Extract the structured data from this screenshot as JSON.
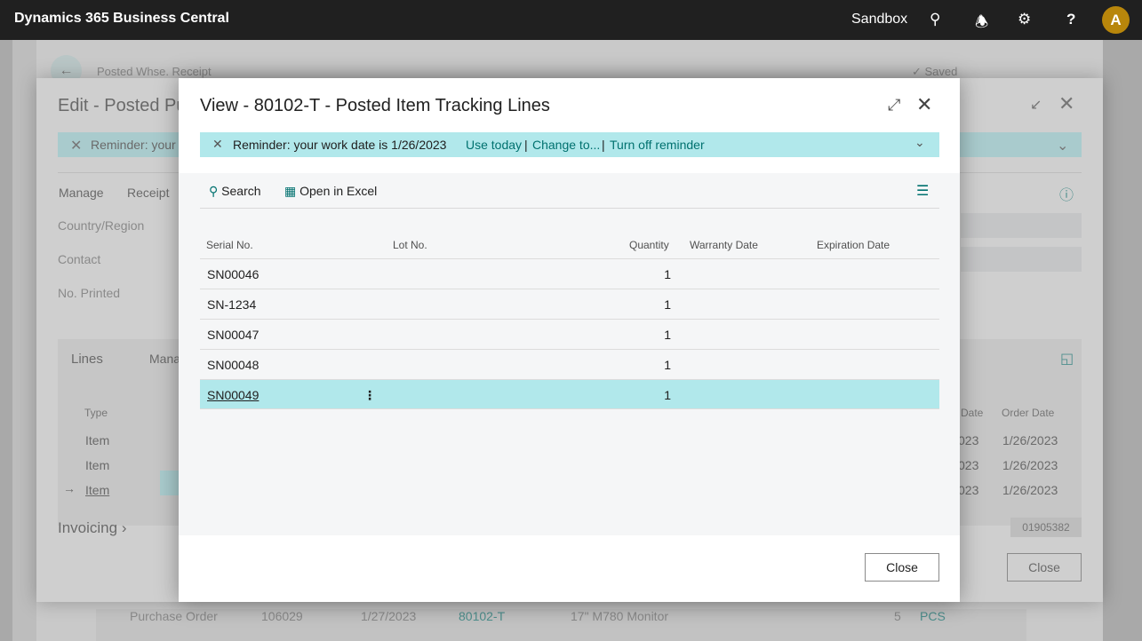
{
  "app": {
    "title": "Dynamics 365 Business Central",
    "environment": "Sandbox",
    "avatar_initial": "A"
  },
  "background_page": {
    "breadcrumb": "Posted Whse. Receipt",
    "saved_label": "Saved",
    "title": "Edit - Posted Pu",
    "reminder": "Reminder: your w",
    "actions": [
      "Manage",
      "Receipt"
    ],
    "fields": [
      "Country/Region",
      "Contact",
      "No. Printed"
    ],
    "lines_tab": "Lines",
    "lines_manage": "Mana",
    "type_header": "Type",
    "date_header_partial": "Date",
    "order_date_header": "Order Date",
    "lines": [
      {
        "type": "Item",
        "date": "023",
        "order_date": "1/26/2023"
      },
      {
        "type": "Item",
        "date": "023",
        "order_date": "1/26/2023"
      },
      {
        "type": "Item",
        "date": "023",
        "order_date": "1/26/2023"
      }
    ],
    "invoicing": "Invoicing",
    "code_box": "01905382",
    "close_label": "Close",
    "bottom_row": {
      "doc_type": "Purchase Order",
      "no": "106029",
      "date": "1/27/2023",
      "item": "80102-T",
      "description": "17\" M780 Monitor",
      "qty": "5",
      "uom": "PCS"
    }
  },
  "dialog": {
    "title": "View - 80102-T - Posted Item Tracking Lines",
    "reminder": {
      "text": "Reminder: your work date is 1/26/2023",
      "use_today": "Use today",
      "change_to": "Change to...",
      "turn_off": "Turn off reminder"
    },
    "toolbar": {
      "search": "Search",
      "open_excel": "Open in Excel"
    },
    "columns": [
      "Serial No.",
      "Lot No.",
      "Quantity",
      "Warranty Date",
      "Expiration Date"
    ],
    "rows": [
      {
        "serial": "SN00046",
        "lot": "",
        "qty": "1",
        "warranty": "",
        "expiration": ""
      },
      {
        "serial": "SN-1234",
        "lot": "",
        "qty": "1",
        "warranty": "",
        "expiration": ""
      },
      {
        "serial": "SN00047",
        "lot": "",
        "qty": "1",
        "warranty": "",
        "expiration": ""
      },
      {
        "serial": "SN00048",
        "lot": "",
        "qty": "1",
        "warranty": "",
        "expiration": ""
      },
      {
        "serial": "SN00049",
        "lot": "",
        "qty": "1",
        "warranty": "",
        "expiration": ""
      }
    ],
    "selected_row": 4,
    "close_label": "Close"
  },
  "colors": {
    "accent": "#00716f",
    "banner": "#b1e8eb",
    "topbar": "#202020"
  }
}
